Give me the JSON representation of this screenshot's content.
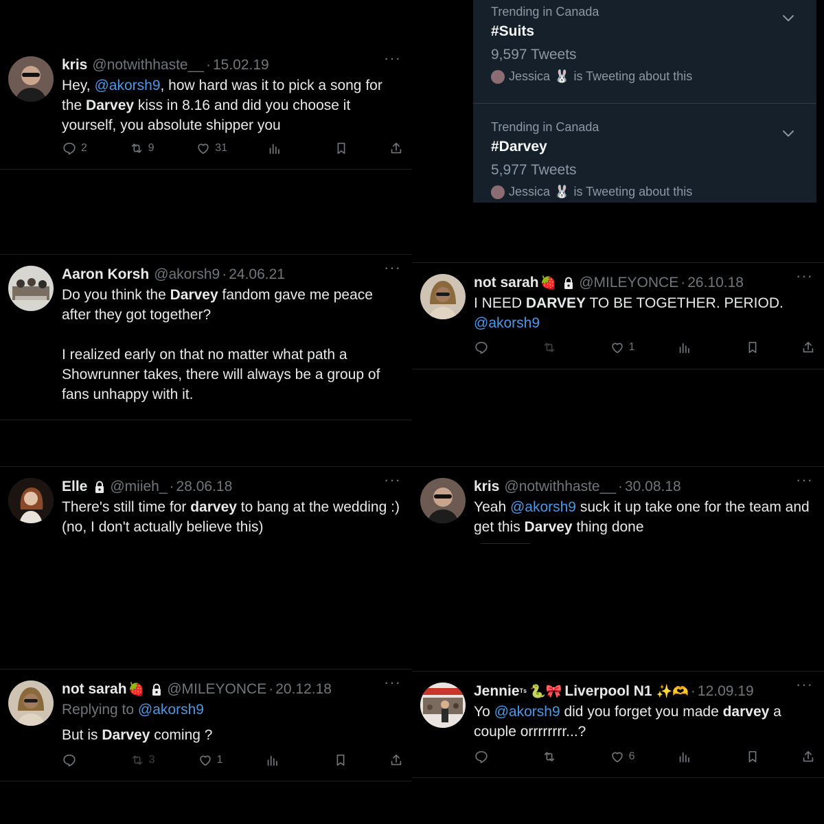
{
  "trending": [
    {
      "meta": "Trending in Canada",
      "tag": "#Suits",
      "count": "9,597 Tweets",
      "user": "Jessica",
      "emoji": "🐰",
      "activity": "is Tweeting about this"
    },
    {
      "meta": "Trending in Canada",
      "tag": "#Darvey",
      "count": "5,977 Tweets",
      "user": "Jessica",
      "emoji": "🐰",
      "activity": "is Tweeting about this"
    }
  ],
  "tweets": {
    "t1": {
      "name": "kris",
      "handle": "@notwithhaste__",
      "date": "15.02.19",
      "p1": "Hey, ",
      "m1": "@akorsh9",
      "p2": ", how hard was it to pick a song for the ",
      "b1": "Darvey",
      "p3": " kiss in 8.16 and did you choose it yourself, you absolute shipper you",
      "replies": "2",
      "retweets": "9",
      "likes": "31"
    },
    "t2": {
      "name": "Aaron Korsh",
      "handle": "@akorsh9",
      "date": "24.06.21",
      "p1": "Do you think the ",
      "b1": "Darvey",
      "p2": " fandom gave me peace after they got together?",
      "para2": "I realized early on that no matter what path a Showrunner takes, there will always be a group of fans unhappy with it."
    },
    "t3": {
      "name": "not sarah",
      "emoji": "🍓",
      "handle": "@MILEYONCE",
      "date": "26.10.18",
      "p1": "I NEED ",
      "b1": "DARVEY",
      "p2": " TO BE TOGETHER. PERIOD.",
      "m1": "@akorsh9",
      "replies": "",
      "retweets": "",
      "likes": "1"
    },
    "t4": {
      "name": "Elle",
      "handle": "@miieh_",
      "date": "28.06.18",
      "p1": "There's still time for ",
      "b1": "darvey",
      "p2": " to bang at the wedding :)",
      "line2": "(no, I don't actually believe this)"
    },
    "t5": {
      "name": "kris",
      "handle": "@notwithhaste__",
      "date": "30.08.18",
      "p1": "Yeah ",
      "m1": "@akorsh9",
      "p2": " suck it up take one for the team and get this ",
      "b1": "Darvey",
      "p3": " thing done"
    },
    "t6": {
      "name": "not sarah",
      "emoji": "🍓",
      "handle": "@MILEYONCE",
      "date": "20.12.18",
      "replying_prefix": "Replying to ",
      "replying_to": "@akorsh9",
      "p1": "But is ",
      "b1": "Darvey",
      "p2": " coming ?",
      "replies": "",
      "retweets": "3",
      "likes": "1"
    },
    "t7": {
      "name": "Jennie",
      "name_sup": "ᵀˢ",
      "emojis": "🐍🎀",
      "name_rest": "Liverpool N1",
      "emojis2": "✨🫶",
      "date": "12.09.19",
      "p1": "Yo ",
      "m1": "@akorsh9",
      "p2": " did you forget you made ",
      "b1": "darvey",
      "p3": " a couple orrrrrrrr...?",
      "replies": "",
      "retweets": "",
      "likes": "6"
    }
  },
  "more_label": "···",
  "colors": {
    "background": "#000000",
    "text": "#e7e9ea",
    "muted": "#71767b",
    "link": "#4a99e9",
    "panel": "#15202b"
  }
}
